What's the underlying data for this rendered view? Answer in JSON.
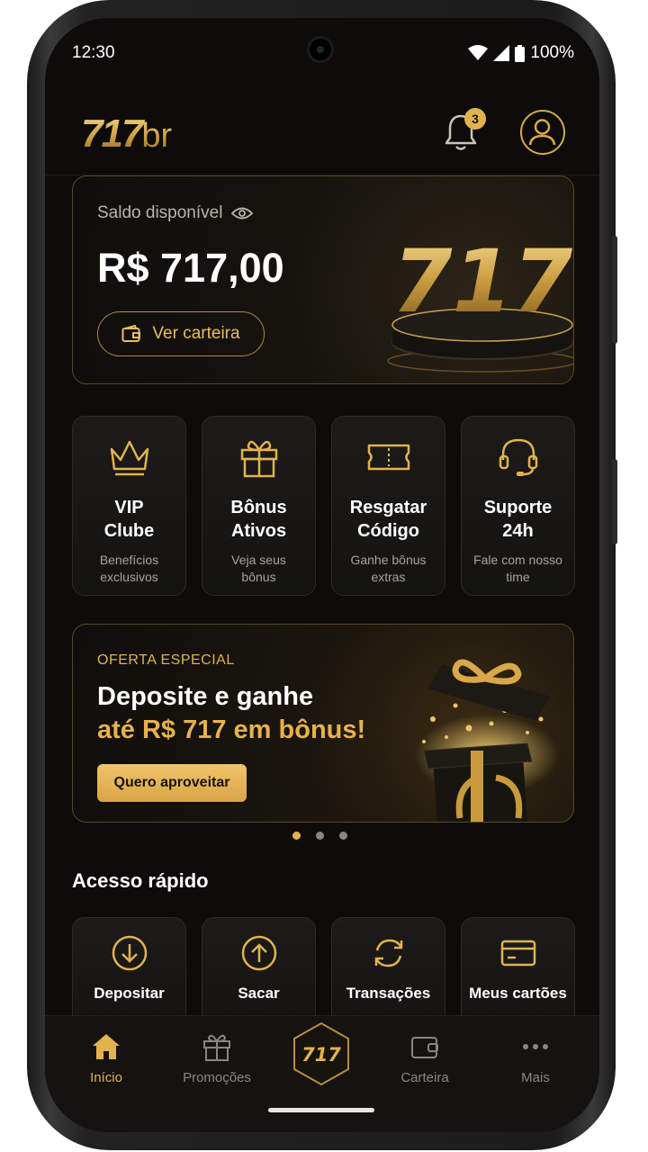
{
  "status_bar": {
    "time": "12:30",
    "battery": "100%"
  },
  "header": {
    "logo_main": "717",
    "logo_suffix": "br",
    "notification_count": "3"
  },
  "balance": {
    "label": "Saldo disponível",
    "amount": "R$ 717,00",
    "wallet_button": "Ver carteira",
    "art_text": "717"
  },
  "tiles": [
    {
      "title_line1": "VIP",
      "title_line2": "Clube",
      "sub_line1": "Benefícios",
      "sub_line2": "exclusivos",
      "icon": "crown-icon"
    },
    {
      "title_line1": "Bônus",
      "title_line2": "Ativos",
      "sub_line1": "Veja seus",
      "sub_line2": "bônus",
      "icon": "gift-icon"
    },
    {
      "title_line1": "Resgatar",
      "title_line2": "Código",
      "sub_line1": "Ganhe bônus",
      "sub_line2": "extras",
      "icon": "ticket-icon"
    },
    {
      "title_line1": "Suporte",
      "title_line2": "24h",
      "sub_line1": "Fale com nosso",
      "sub_line2": "time",
      "icon": "headset-icon"
    }
  ],
  "promo": {
    "kicker": "OFERTA ESPECIAL",
    "headline1": "Deposite e ganhe",
    "headline2": "até R$ 717 em bônus!",
    "cta": "Quero aproveitar",
    "carousel_active_index": 0,
    "carousel_count": 3
  },
  "quick_access": {
    "title": "Acesso rápido",
    "items": [
      {
        "label": "Depositar",
        "icon": "download-circle-icon"
      },
      {
        "label": "Sacar",
        "icon": "upload-circle-icon"
      },
      {
        "label": "Transações",
        "icon": "refresh-icon"
      },
      {
        "label": "Meus cartões",
        "icon": "card-icon"
      }
    ]
  },
  "bottom_nav": {
    "items": [
      {
        "label": "Início",
        "icon": "home-icon",
        "active": true
      },
      {
        "label": "Promoções",
        "icon": "gift-icon",
        "active": false
      },
      {
        "label": "717",
        "icon": "hexagon-logo-icon",
        "active": false
      },
      {
        "label": "Carteira",
        "icon": "wallet-icon",
        "active": false
      },
      {
        "label": "Mais",
        "icon": "more-dots-icon",
        "active": false
      }
    ]
  },
  "colors": {
    "accent_gold": "#e2b24f",
    "background": "#0d0c0b",
    "border_gold": "#5c4723"
  }
}
